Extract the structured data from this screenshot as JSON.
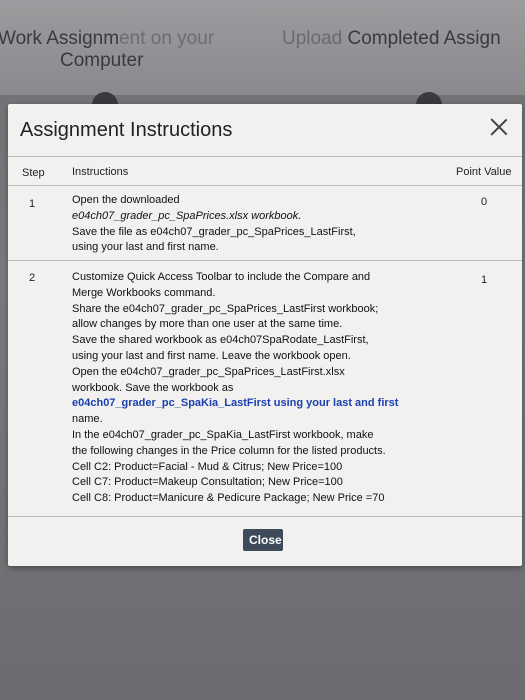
{
  "background": {
    "link1_line1_a": "Work Assignm",
    "link1_line1_b": "ent on your",
    "link1_line2": "Computer",
    "link2_a": "Upload ",
    "link2_b": "Completed Assign"
  },
  "modal": {
    "title": "Assignment Instructions",
    "close_label": "Close",
    "columns": {
      "step": "Step",
      "instructions": "Instructions",
      "points": "Point Value"
    },
    "rows": [
      {
        "step": "1",
        "points": "0",
        "lines": [
          "Open the downloaded",
          "e04ch07_grader_pc_SpaPrices.xlsx workbook.",
          "Save the file as e04ch07_grader_pc_SpaPrices_LastFirst,",
          "using your last and first name."
        ]
      },
      {
        "step": "2",
        "points": "1",
        "lines": [
          "Customize Quick Access Toolbar to include the Compare and",
          "Merge Workbooks command.",
          "Share the e04ch07_grader_pc_SpaPrices_LastFirst workbook;",
          "allow changes by more than one user at the same time.",
          "Save the shared workbook as e04ch07SpaRodate_LastFirst,",
          "using your last and first name. Leave the workbook open.",
          "Open the e04ch07_grader_pc_SpaPrices_LastFirst.xlsx",
          "workbook. Save the workbook as",
          "e04ch07_grader_pc_SpaKia_LastFirst using your last and first",
          "name.",
          "In the e04ch07_grader_pc_SpaKia_LastFirst workbook, make",
          "the following changes in the Price column for the listed products.",
          "Cell C2: Product=Facial - Mud & Citrus; New Price=100",
          "Cell C7: Product=Makeup Consultation; New Price=100",
          "Cell C8: Product=Manicure & Pedicure Package; New Price =70"
        ]
      }
    ]
  }
}
